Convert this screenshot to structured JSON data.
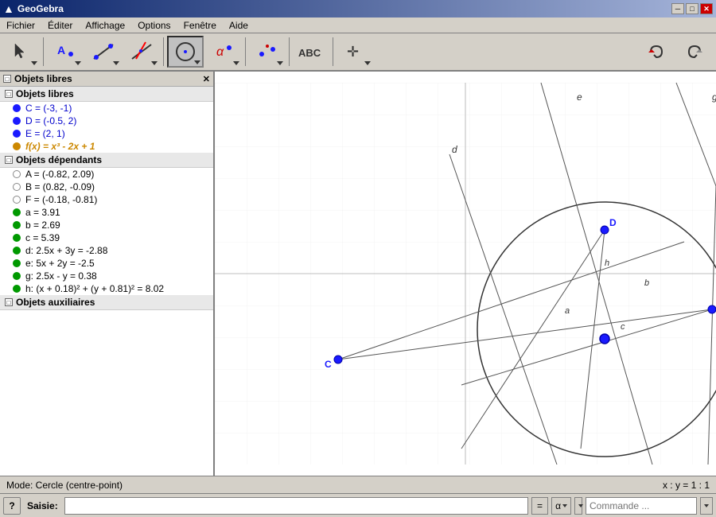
{
  "app": {
    "title": "GeoGebra",
    "icon": "▲"
  },
  "titlebar": {
    "minimize": "─",
    "maximize": "□",
    "close": "✕"
  },
  "menu": {
    "items": [
      "Fichier",
      "Éditer",
      "Affichage",
      "Options",
      "Fenêtre",
      "Aide"
    ]
  },
  "toolbar": {
    "tools": [
      {
        "id": "select",
        "icon": "↖",
        "has_dropdown": true,
        "active": false
      },
      {
        "id": "point",
        "icon": "A",
        "has_dropdown": true,
        "active": false
      },
      {
        "id": "line",
        "icon": "/",
        "has_dropdown": true,
        "active": false
      },
      {
        "id": "perpendicular",
        "icon": "⊥",
        "has_dropdown": true,
        "active": false
      },
      {
        "id": "circle",
        "icon": "◯",
        "has_dropdown": true,
        "active": true
      },
      {
        "id": "conic",
        "icon": "α",
        "has_dropdown": true,
        "active": false
      },
      {
        "id": "measure",
        "icon": "•",
        "has_dropdown": true,
        "active": false
      },
      {
        "id": "text",
        "icon": "ABC",
        "has_dropdown": false,
        "active": false
      },
      {
        "id": "move",
        "icon": "✛",
        "has_dropdown": true,
        "active": false
      }
    ]
  },
  "left_panel": {
    "title": "Objets libres",
    "sections": [
      {
        "id": "free",
        "label": "Objets libres",
        "items": [
          {
            "type": "point",
            "color": "#0000cc",
            "text": "C = (-3, -1)",
            "bold": false
          },
          {
            "type": "point",
            "color": "#0000cc",
            "text": "D = (-0.5, 2)",
            "bold": false
          },
          {
            "type": "point",
            "color": "#0000cc",
            "text": "E = (2, 1)",
            "bold": false
          },
          {
            "type": "function",
            "color": "#cc8800",
            "text": "f(x) = x³ - 2x + 1",
            "bold": true
          }
        ]
      },
      {
        "id": "dependent",
        "label": "Objets dépendants",
        "items": [
          {
            "type": "point",
            "color": "#888",
            "text": "A = (-0.82, 2.09)",
            "bold": false
          },
          {
            "type": "point",
            "color": "#888",
            "text": "B = (0.82, -0.09)",
            "bold": false
          },
          {
            "type": "point",
            "color": "#888",
            "text": "F = (-0.18, -0.81)",
            "bold": false
          },
          {
            "type": "segment",
            "color": "#00aa00",
            "text": "a = 3.91",
            "bold": false
          },
          {
            "type": "segment",
            "color": "#00aa00",
            "text": "b = 2.69",
            "bold": false
          },
          {
            "type": "segment",
            "color": "#00aa00",
            "text": "c = 5.39",
            "bold": false
          },
          {
            "type": "line",
            "color": "#00aa00",
            "text": "d: 2.5x + 3y = -2.88",
            "bold": false
          },
          {
            "type": "line",
            "color": "#00aa00",
            "text": "e: 5x + 2y = -2.5",
            "bold": false
          },
          {
            "type": "line",
            "color": "#00aa00",
            "text": "g: 2.5x - y = 0.38",
            "bold": false
          },
          {
            "type": "circle",
            "color": "#00aa00",
            "text": "h: (x + 0.18)² + (y + 0.81)² = 8.02",
            "bold": false
          }
        ]
      },
      {
        "id": "auxiliary",
        "label": "Objets auxiliaires",
        "items": []
      }
    ]
  },
  "status": {
    "mode": "Mode: Cercle (centre-point)",
    "coords": "x : y = 1 : 1"
  },
  "input_bar": {
    "help_label": "?",
    "saisie_label": "Saisie:",
    "saisie_placeholder": "",
    "equals_btn": "=",
    "alpha_dropdown": "α",
    "commande_placeholder": "Commande ..."
  },
  "colors": {
    "blue_point": "#1a1aff",
    "green_line": "#009900",
    "orange_func": "#cc8800",
    "circle_stroke": "#333333",
    "line_stroke": "#555555"
  }
}
